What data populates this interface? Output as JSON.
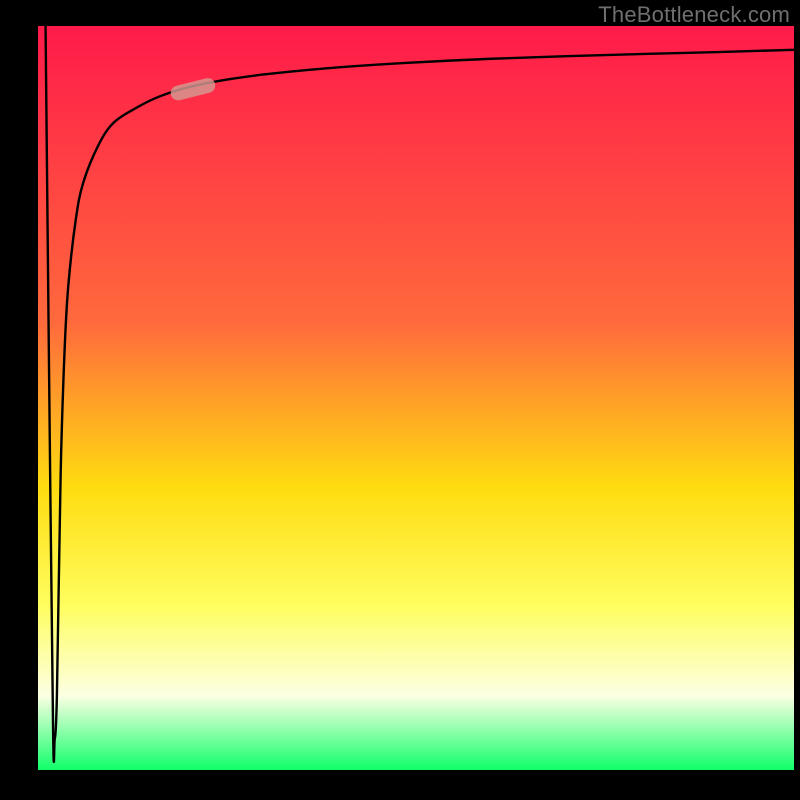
{
  "attribution": "TheBottleneck.com",
  "colors": {
    "gradient_top": "#ff1a4a",
    "gradient_upper_mid": "#ff6a3c",
    "gradient_mid": "#ffdc10",
    "gradient_lower_mid": "#fffe60",
    "gradient_near_bottom": "#fcffe3",
    "gradient_bottom": "#10ff6a",
    "curve": "#000000",
    "marker_fill": "#d49a93",
    "marker_fill_alpha": 0.82
  },
  "chart_data": {
    "type": "line",
    "title": "",
    "xlabel": "",
    "ylabel": "",
    "xlim": [
      0,
      100
    ],
    "ylim": [
      0,
      100
    ],
    "series": [
      {
        "name": "bottleneck-curve",
        "x": [
          1,
          1.5,
          2,
          2.2,
          2.5,
          3,
          3.5,
          4,
          5,
          6,
          8,
          10,
          13,
          16,
          20,
          25,
          30,
          38,
          48,
          60,
          75,
          90,
          100
        ],
        "y": [
          100,
          50,
          5,
          4,
          10,
          40,
          56,
          65,
          74,
          79,
          84,
          87,
          89,
          90.5,
          91.8,
          92.8,
          93.5,
          94.3,
          95.0,
          95.6,
          96.1,
          96.5,
          96.8
        ]
      }
    ],
    "markers": [
      {
        "name": "highlight-segment",
        "shape": "pill",
        "x_center": 20.5,
        "y_center": 91.5,
        "length": 6,
        "width": 2.0,
        "angle_deg": -14
      }
    ],
    "gradient_bands_y": [
      {
        "y": 100,
        "color": "gradient_top"
      },
      {
        "y": 60,
        "color": "gradient_upper_mid"
      },
      {
        "y": 38,
        "color": "gradient_mid"
      },
      {
        "y": 22,
        "color": "gradient_lower_mid"
      },
      {
        "y": 10,
        "color": "gradient_near_bottom"
      },
      {
        "y": 0,
        "color": "gradient_bottom"
      }
    ]
  }
}
